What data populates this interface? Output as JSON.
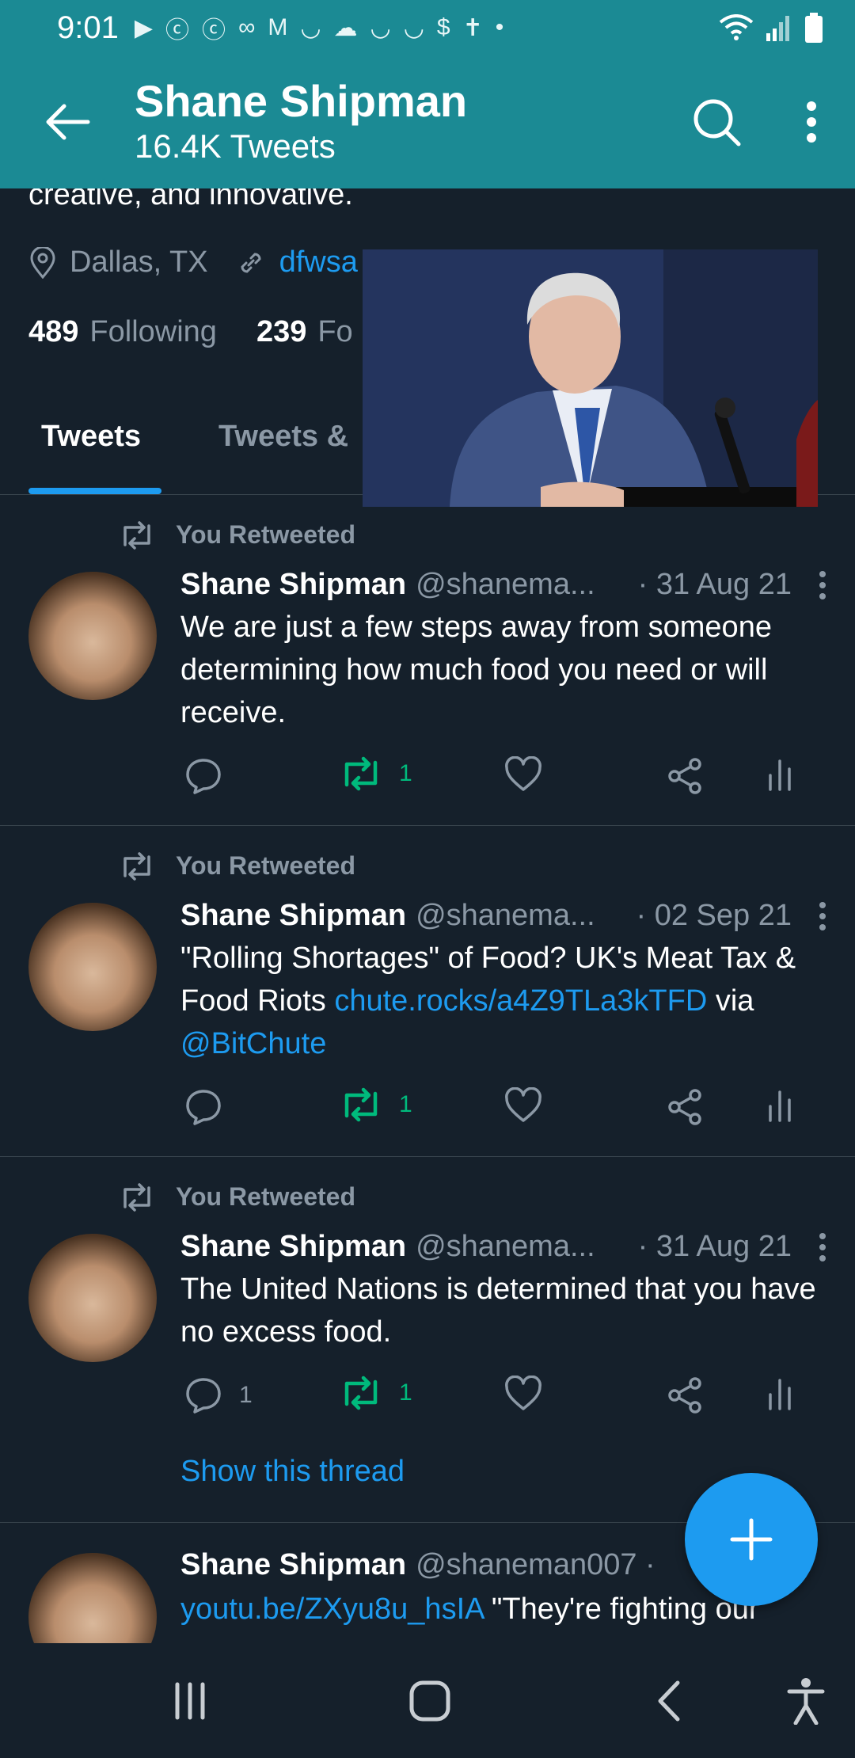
{
  "status_bar": {
    "time": "9:01",
    "icons": [
      "youtube-icon",
      "c-icon",
      "c-icon",
      "voicemail-icon",
      "gmail-icon",
      "smile-icon",
      "cloud-icon",
      "smile-icon",
      "smile-icon",
      "dollar-icon",
      "accessibility-icon",
      "dot-icon"
    ],
    "right_icons": [
      "wifi-icon",
      "signal-icon",
      "battery-icon"
    ]
  },
  "header": {
    "name": "Shane Shipman",
    "tweet_count": "16.4K Tweets"
  },
  "profile": {
    "bio_tail": "creative, and innovative.",
    "location": "Dallas, TX",
    "website": "dfwsa",
    "following_count": "489",
    "following_label": "Following",
    "followers_count": "239",
    "followers_label": "Fo"
  },
  "tabs": {
    "active": "Tweets",
    "second": "Tweets &"
  },
  "tweets": [
    {
      "retweet_label": "You Retweeted",
      "name": "Shane Shipman",
      "handle": "@shanema...",
      "date": "· 31 Aug 21",
      "text": "We are just a few steps away from someone determining how much food you need or will receive.",
      "replies": "",
      "retweets": "1",
      "likes": ""
    },
    {
      "retweet_label": "You Retweeted",
      "name": "Shane Shipman",
      "handle": "@shanema...",
      "date": "· 02 Sep 21",
      "text_before": "\"Rolling Shortages\" of Food? UK's Meat Tax & Food Riots ",
      "link": "chute.rocks/a4Z9TLa3kTFD",
      "text_mid": " via ",
      "mention": "@BitChute",
      "replies": "",
      "retweets": "1",
      "likes": ""
    },
    {
      "retweet_label": "You Retweeted",
      "name": "Shane Shipman",
      "handle": "@shanema...",
      "date": "· 31 Aug 21",
      "text": "The United Nations is determined that you have no excess food.",
      "replies": "1",
      "retweets": "1",
      "likes": "",
      "show_thread": "Show this thread"
    },
    {
      "name": "Shane Shipman",
      "handle": "@shaneman007 ·",
      "link": "youtu.be/ZXyu8u_hsIA",
      "text_after": " \"They're fighting our"
    }
  ],
  "colors": {
    "header_bg": "#1b8a94",
    "page_bg": "#15202b",
    "accent": "#1d9bf0",
    "retweet_green": "#00ba7c",
    "muted": "#8b98a5"
  }
}
